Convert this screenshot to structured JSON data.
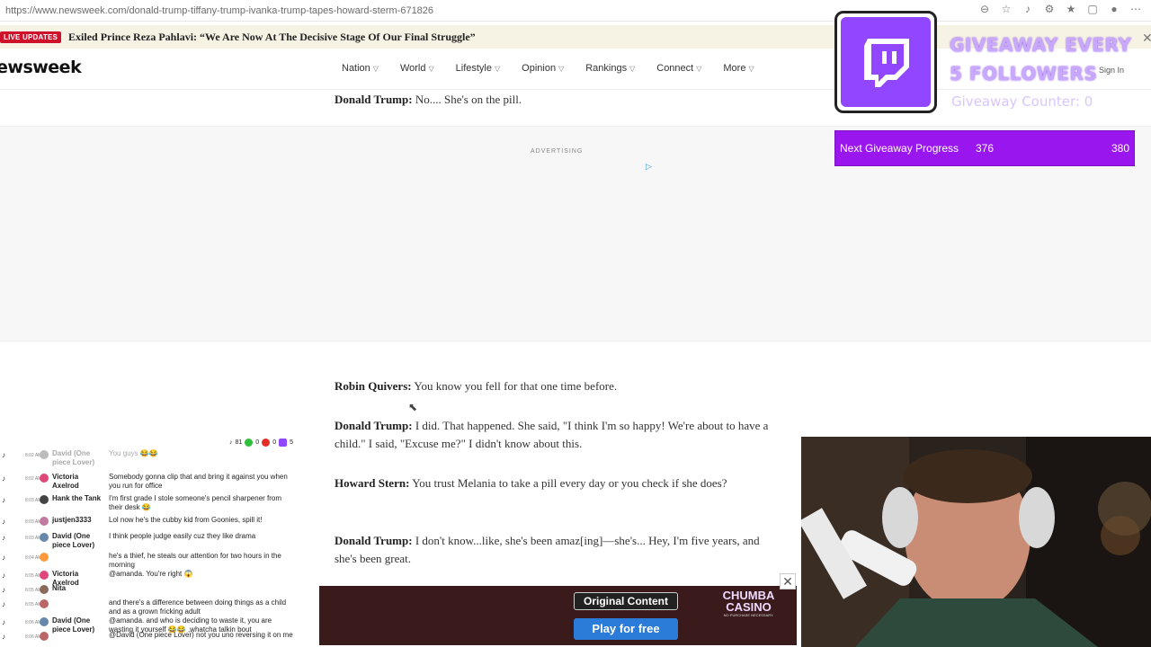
{
  "browser": {
    "url": "https://www.newsweek.com/donald-trump-tiffany-trump-ivanka-trump-tapes-howard-sterm-671826"
  },
  "banner": {
    "badge": "LIVE UPDATES",
    "headline": "Exiled Prince Reza Pahlavi: “We Are Now At The Decisive Stage Of Our Final Struggle”"
  },
  "site": {
    "logo": "ewsweek",
    "nav": [
      "Nation",
      "World",
      "Lifestyle",
      "Opinion",
      "Rankings",
      "Connect",
      "More"
    ],
    "signin": "Sign In"
  },
  "article": {
    "advertising_label": "ADVERTISING",
    "paragraphs": [
      {
        "speaker": "Donald Trump:",
        "text": " No.... She's on the pill."
      },
      {
        "speaker": "Robin Quivers:",
        "text": " You know you fell for that one time before."
      },
      {
        "speaker": "Donald Trump:",
        "text": " I did. That happened. She said, \"I think I'm so happy! We're about to have a child.\" I said, \"Excuse me?\" I didn't know about this."
      },
      {
        "speaker": "Howard Stern:",
        "text": " You trust Melania to take a pill every day or you check if she does?"
      },
      {
        "speaker": "Donald Trump:",
        "text": " I don't know...like, she's been amaz[ing]—she's... Hey, I'm five years, and she's been great."
      }
    ]
  },
  "overlay": {
    "giveaway_line1": "GIVEAWAY EVERY",
    "giveaway_line2": "5 FOLLOWERS",
    "giveaway_counter": "Giveaway Counter: 0",
    "progress_label": "Next Giveaway Progress",
    "progress_current": "376",
    "progress_goal": "380",
    "progress_fraction": 0.989
  },
  "chat": {
    "stats": [
      "81",
      "0",
      "0",
      "5"
    ],
    "messages": [
      {
        "time": "8:02 AM",
        "name": "David (One piece Lover)",
        "msg": "You guys 😂😂",
        "ghost": true,
        "avatar": "#bbbbbb"
      },
      {
        "time": "8:02 AM",
        "name": "Victoria Axelrod",
        "msg": "Somebody gonna clip that and bring it against you when you run for office",
        "avatar": "#e0487a"
      },
      {
        "time": "8:03 AM",
        "name": "Hank the Tank",
        "msg": "I'm first grade I stole someone's pencil sharpener from their desk 😂",
        "avatar": "#444444"
      },
      {
        "time": "8:03 AM",
        "name": "justjen3333",
        "msg": "Lol now he's the cubby kid from Goonies, spill it!",
        "avatar": "#c27aa0"
      },
      {
        "time": "8:03 AM",
        "name": "David (One piece Lover)",
        "msg": "I think people judge easily cuz they like drama",
        "avatar": "#6688aa"
      },
      {
        "time": "8:04 AM",
        "name": "",
        "msg": "he's a thief, he steals our attention for two hours in the morning",
        "avatar": "#ff9a3c"
      },
      {
        "time": "8:05 AM",
        "name": "Victoria Axelrod",
        "msg": "@amanda. You're right 😱",
        "avatar": "#e0487a"
      },
      {
        "time": "8:05 AM",
        "name": "Nita",
        "msg": "",
        "avatar": "#8a6a5a"
      },
      {
        "time": "8:05 AM",
        "name": "",
        "msg": "and there's a difference between doing things as a child and as a grown fricking adult",
        "avatar": "#b66"
      },
      {
        "time": "8:06 AM",
        "name": "David (One piece Lover)",
        "msg": "@amanda. and who is deciding to waste it, you are wasting it yourself 😂😂 ,whatcha talkin bout",
        "avatar": "#6688aa"
      },
      {
        "time": "8:06 AM",
        "name": "",
        "msg": "@David (One piece Lover) not you uno reversing it on me",
        "avatar": "#b66"
      }
    ]
  },
  "bottom_ad": {
    "badge": "Original Content",
    "button": "Play for free",
    "brand_line1": "CHUMBA",
    "brand_line2": "CASINO",
    "fine": "NO PURCHASE NECESSARY."
  },
  "colors": {
    "twitch_purple": "#9146ff",
    "progress_bg": "#9a16ee",
    "live_red": "#d0112b"
  }
}
